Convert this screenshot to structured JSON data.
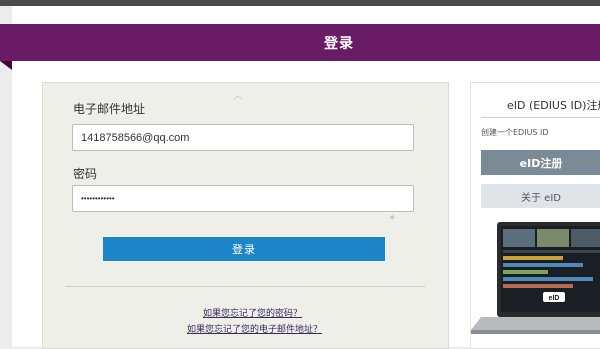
{
  "header": {
    "title": "登录"
  },
  "login_form": {
    "email_label": "电子邮件地址",
    "email_value": "1418758566@qq.com",
    "password_label": "密码",
    "password_value": "••••••••••••",
    "login_button": "登录",
    "forgot_password_link": "如果您忘记了您的密码？",
    "forgot_email_link": "如果您忘记了您的电子邮件地址？"
  },
  "eid_panel": {
    "title": "eID (EDIUS ID)注册",
    "subtitle": "创建一个EDIUS ID",
    "register_button": "eID注册",
    "about_button": "关于 eID",
    "laptop_logo": "eID"
  },
  "colors": {
    "banner": "#6a1b66",
    "login_button": "#1e86c8",
    "register_button": "#7a8b97"
  }
}
